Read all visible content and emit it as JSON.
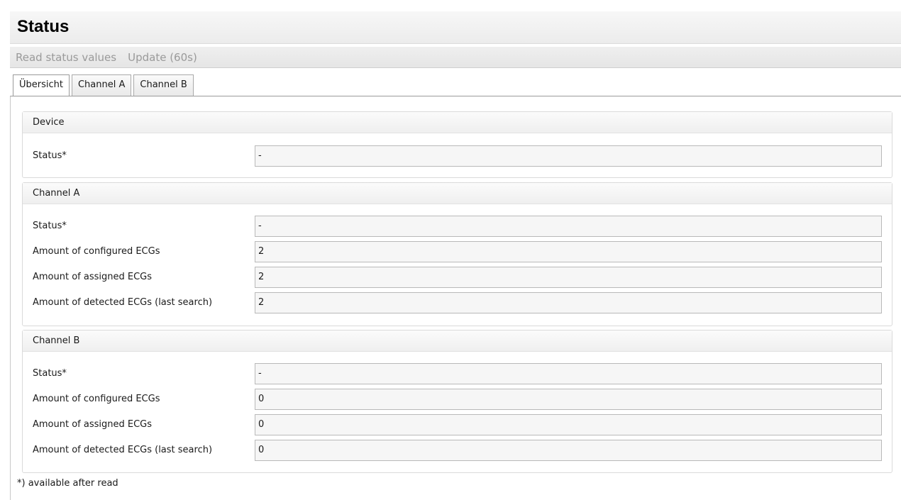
{
  "window": {
    "title": "Status"
  },
  "toolbar": {
    "read_label": "Read status values",
    "update_label": "Update (60s)"
  },
  "tabs": [
    {
      "label": "Übersicht",
      "active": true
    },
    {
      "label": "Channel A",
      "active": false
    },
    {
      "label": "Channel B",
      "active": false
    }
  ],
  "device": {
    "title": "Device",
    "status_label": "Status*",
    "status_value": "-"
  },
  "channel_a": {
    "title": "Channel A",
    "status_label": "Status*",
    "status_value": "-",
    "configured_label": "Amount of configured ECGs",
    "configured_value": "2",
    "assigned_label": "Amount of assigned ECGs",
    "assigned_value": "2",
    "detected_label": "Amount of detected ECGs (last search)",
    "detected_value": "2"
  },
  "channel_b": {
    "title": "Channel B",
    "status_label": "Status*",
    "status_value": "-",
    "configured_label": "Amount of configured ECGs",
    "configured_value": "0",
    "assigned_label": "Amount of assigned ECGs",
    "assigned_value": "0",
    "detected_label": "Amount of detected ECGs (last search)",
    "detected_value": "0"
  },
  "footnote": "*) available after read"
}
